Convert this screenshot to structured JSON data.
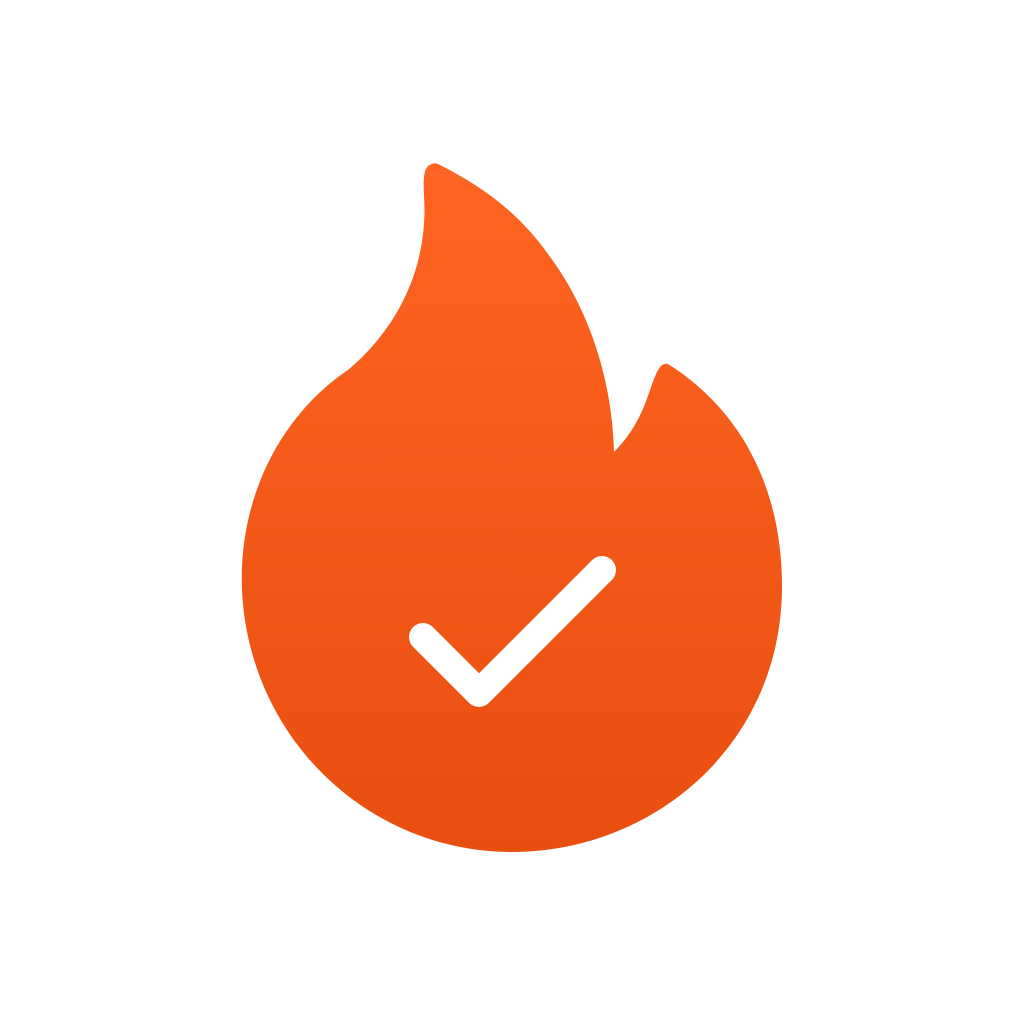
{
  "icon": {
    "name": "flame-check-icon",
    "glyphs": [
      "flame-icon",
      "checkmark-icon"
    ]
  },
  "colors": {
    "background": "#ffffff",
    "flame_top": "#ff6422",
    "flame_bottom": "#e84e0e",
    "checkmark": "#ffffff"
  }
}
